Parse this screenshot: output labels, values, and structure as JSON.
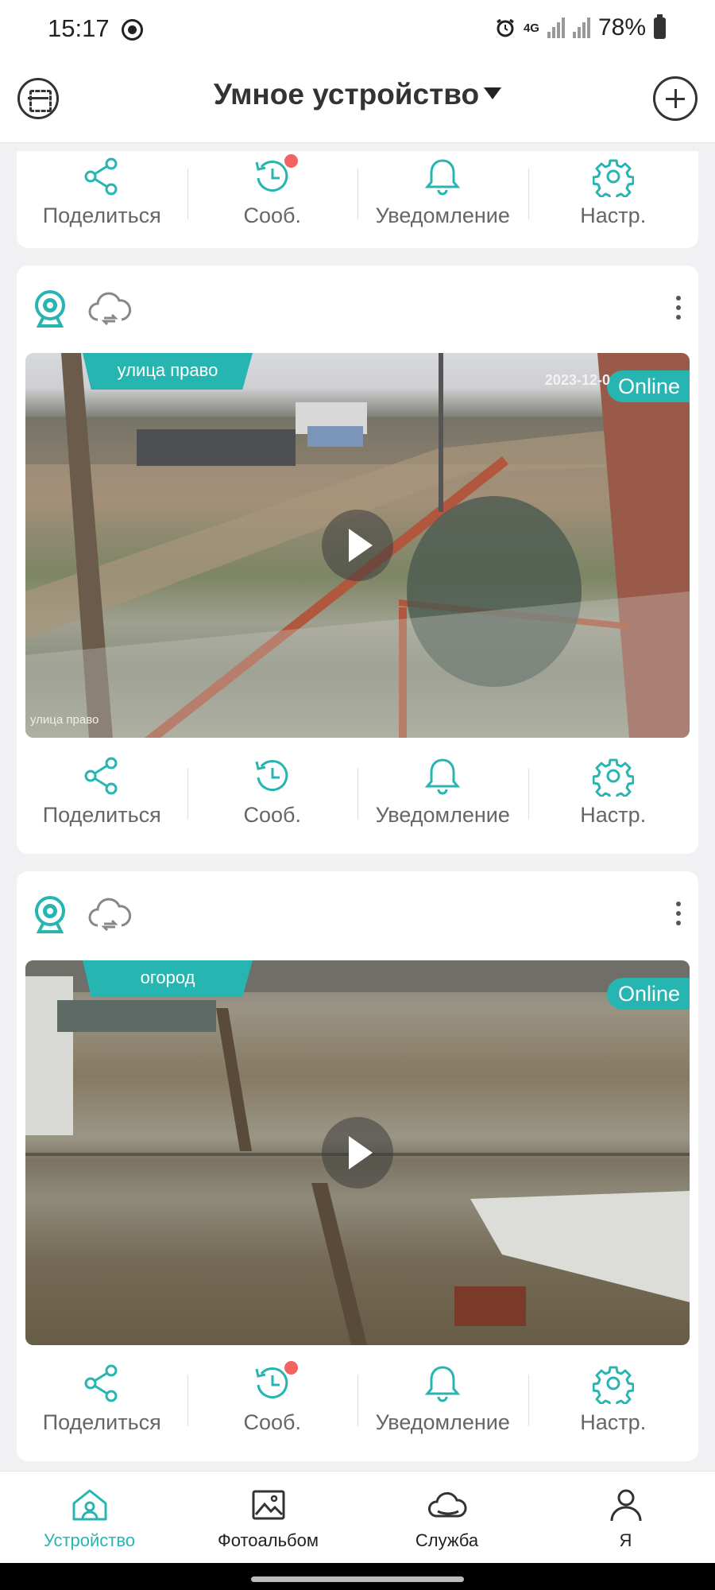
{
  "status_bar": {
    "time": "15:17",
    "network": "4G",
    "battery": "78%"
  },
  "header": {
    "title": "Умное устройство"
  },
  "actions": {
    "share": "Поделиться",
    "messages": "Сооб.",
    "notification": "Уведомление",
    "settings": "Настр."
  },
  "cameras": [
    {
      "name": "улица право",
      "status": "Online",
      "timestamp": "2023-12-0",
      "osd": "улица право",
      "messages_unread": true
    },
    {
      "name": "огород",
      "status": "Online",
      "messages_unread": true
    }
  ],
  "top_card": {
    "messages_unread": true
  },
  "bottom_nav": {
    "items": [
      {
        "label": "Устройство",
        "icon": "home-icon",
        "active": true
      },
      {
        "label": "Фотоальбом",
        "icon": "photo-album-icon",
        "active": false
      },
      {
        "label": "Служба",
        "icon": "cloud-service-icon",
        "active": false
      },
      {
        "label": "Я",
        "icon": "profile-icon",
        "active": false
      }
    ]
  },
  "colors": {
    "accent": "#27b5b1",
    "badge": "#f26462",
    "background": "#f1f1f3"
  }
}
